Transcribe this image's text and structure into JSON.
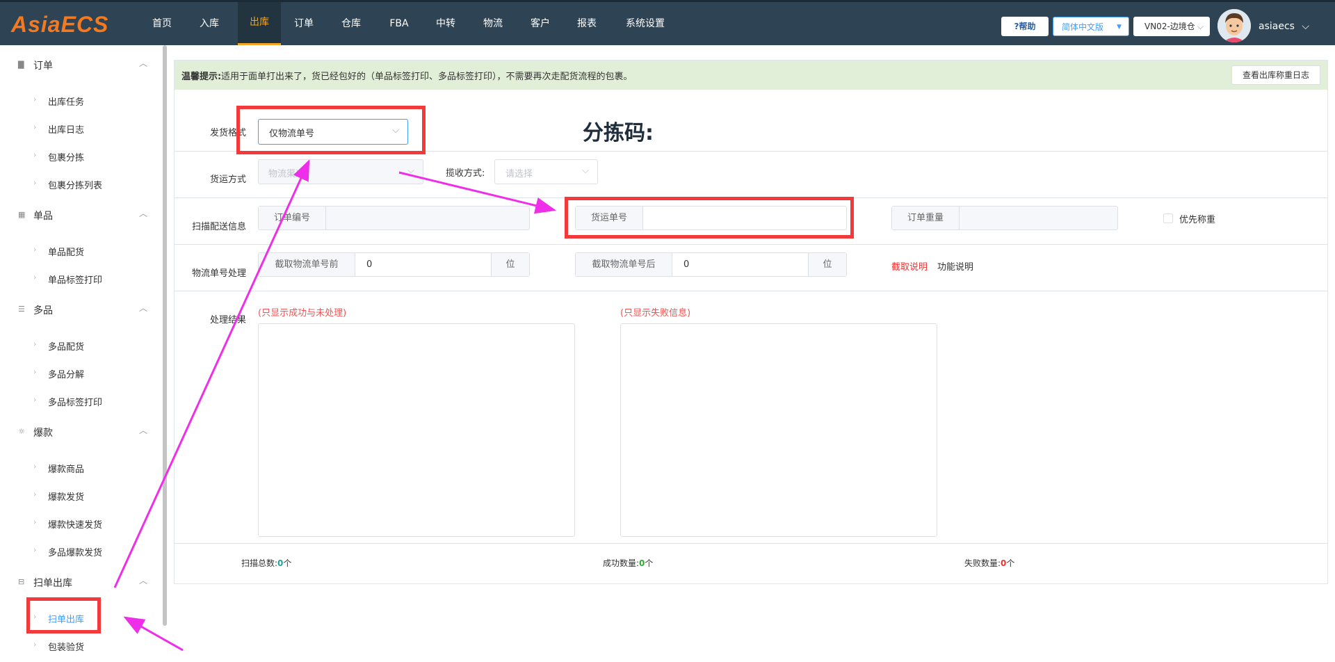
{
  "app": {
    "logo": "AsiaECS"
  },
  "nav": [
    "首页",
    "入库",
    "出库",
    "订单",
    "仓库",
    "FBA",
    "中转",
    "物流",
    "客户",
    "报表",
    "系统设置"
  ],
  "header": {
    "help": "?帮助",
    "language": "简体中文版",
    "warehouse": "VN02-边境仓",
    "user": "asiaecs"
  },
  "sidebar": {
    "groups": [
      {
        "label": "订单",
        "items": [
          "出库任务",
          "出库日志",
          "包裹分拣",
          "包裹分拣列表"
        ]
      },
      {
        "label": "单品",
        "items": [
          "单品配货",
          "单品标签打印"
        ]
      },
      {
        "label": "多品",
        "items": [
          "多品配货",
          "多品分解",
          "多品标签打印"
        ]
      },
      {
        "label": "爆款",
        "items": [
          "爆款商品",
          "爆款发货",
          "爆款快速发货",
          "多品爆款发货"
        ]
      },
      {
        "label": "扫单出库",
        "items": [
          "扫单出库",
          "包装验货"
        ]
      }
    ],
    "active_item": "扫单出库"
  },
  "notice": {
    "label": "温馨提示:",
    "text": "适用于面单打出来了，货已经包好的（单品标签打印、多品标签打印），不需要再次走配货流程的包裹。",
    "log_button": "查看出库称重日志"
  },
  "form": {
    "ship_format_label": "发货格式",
    "ship_format_value": "仅物流单号",
    "sort_code": "分拣码:",
    "transport_label": "货运方式",
    "channel_placeholder": "物流渠道",
    "pickup_label": "揽收方式:",
    "pickup_placeholder": "请选择",
    "scan_label": "扫描配送信息",
    "order_no": "订单编号",
    "tracking_no": "货运单号",
    "order_weight": "订单重量",
    "priority_weigh": "优先称重",
    "tracking_proc_label": "物流单号处理",
    "cut_before": "截取物流单号前",
    "cut_before_value": "0",
    "cut_after": "截取物流单号后",
    "cut_after_value": "0",
    "unit": "位",
    "cut_help": "截取说明",
    "func_help": "功能说明",
    "result_label": "处理结果",
    "success_hint": "(只显示成功与未处理)",
    "fail_hint": "(只显示失败信息)"
  },
  "stats": {
    "total_label": "扫描总数:",
    "total": "0",
    "success_label": "成功数量:",
    "success": "0",
    "fail_label": "失败数量:",
    "fail": "0",
    "unit": "个"
  },
  "colors": {
    "topbar": "#2e4354",
    "accent": "#f5a623",
    "logo": "#f4791f",
    "annotation_box": "#f23a3a",
    "annotation_arrow": "#ee2ee8",
    "notice_bg": "#e1eed8"
  }
}
